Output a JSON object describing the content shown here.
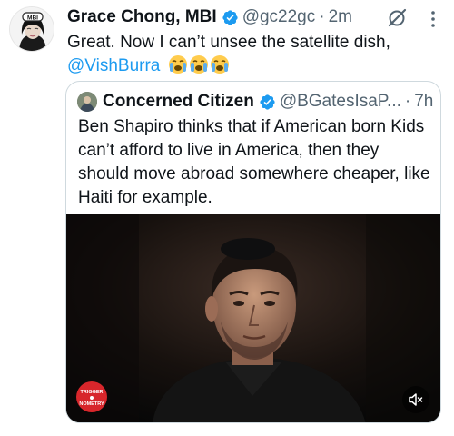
{
  "tweet": {
    "author_name": "Grace Chong, MBI",
    "author_handle": "@gc22gc",
    "dot": "·",
    "time": "2m",
    "avatar_badge": "MBI",
    "text": "Great. Now I can’t unsee the satellite dish,",
    "mention": "@VishBurra",
    "emojis": [
      "loudly-crying-face",
      "loudly-crying-face",
      "loudly-crying-face"
    ]
  },
  "quote": {
    "author_name": "Concerned Citizen",
    "author_handle": "@BGatesIsaP...",
    "dot": "·",
    "time": "7h",
    "text": "Ben Shapiro thinks that if American born Kids can’t afford to live in America, then they should move abroad somewhere cheaper, like Haiti for example.",
    "media": {
      "logo_text_top": "TRIGGER",
      "logo_text_bottom": "NOMETRY"
    }
  },
  "colors": {
    "verified": "#1d9bf0",
    "link": "#1d9bf0",
    "secondary_text": "#536471",
    "logo_red": "#d7262b"
  }
}
